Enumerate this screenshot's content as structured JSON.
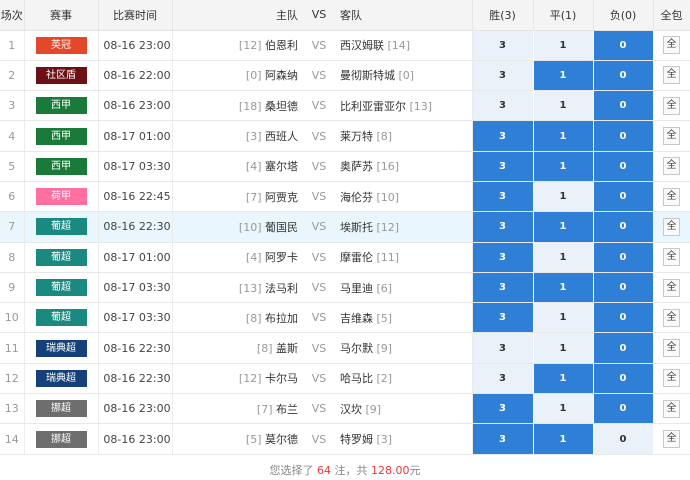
{
  "header": {
    "idx": "场次",
    "league": "赛事",
    "time": "比赛时间",
    "home": "主队",
    "vs": "VS",
    "away": "客队",
    "win": "胜(3)",
    "draw": "平(1)",
    "lose": "负(0)",
    "all": "全包"
  },
  "colors": {
    "selected_option": "#2f7fd6",
    "unselected_option": "#ebf1f8",
    "highlight_row": "#eaf6fd"
  },
  "matches": [
    {
      "idx": "1",
      "league": "英冠",
      "league_color": "#e4472a",
      "time": "08-16 23:00",
      "home_rank": "[12]",
      "home": "伯恩利",
      "vs": "VS",
      "away": "西汉姆联",
      "away_rank": "[14]",
      "win": "3",
      "draw": "1",
      "lose": "0",
      "sel": [
        false,
        false,
        true
      ],
      "all": "全"
    },
    {
      "idx": "2",
      "league": "社区盾",
      "league_color": "#6b1014",
      "time": "08-16 22:00",
      "home_rank": "[0]",
      "home": "阿森纳",
      "vs": "VS",
      "away": "曼彻斯特城",
      "away_rank": "[0]",
      "win": "3",
      "draw": "1",
      "lose": "0",
      "sel": [
        false,
        true,
        true
      ],
      "all": "全"
    },
    {
      "idx": "3",
      "league": "西甲",
      "league_color": "#1a7a3a",
      "time": "08-16 23:00",
      "home_rank": "[18]",
      "home": "桑坦德",
      "vs": "VS",
      "away": "比利亚雷亚尔",
      "away_rank": "[13]",
      "win": "3",
      "draw": "1",
      "lose": "0",
      "sel": [
        false,
        false,
        true
      ],
      "all": "全"
    },
    {
      "idx": "4",
      "league": "西甲",
      "league_color": "#1a7a3a",
      "time": "08-17 01:00",
      "home_rank": "[3]",
      "home": "西班人",
      "vs": "VS",
      "away": "莱万特",
      "away_rank": "[8]",
      "win": "3",
      "draw": "1",
      "lose": "0",
      "sel": [
        true,
        true,
        true
      ],
      "all": "全"
    },
    {
      "idx": "5",
      "league": "西甲",
      "league_color": "#1a7a3a",
      "time": "08-17 03:30",
      "home_rank": "[4]",
      "home": "塞尔塔",
      "vs": "VS",
      "away": "奥萨苏",
      "away_rank": "[16]",
      "win": "3",
      "draw": "1",
      "lose": "0",
      "sel": [
        true,
        true,
        true
      ],
      "all": "全"
    },
    {
      "idx": "6",
      "league": "荷甲",
      "league_color": "#ff6fa0",
      "time": "08-16 22:45",
      "home_rank": "[7]",
      "home": "阿贾克",
      "vs": "VS",
      "away": "海伦芬",
      "away_rank": "[10]",
      "win": "3",
      "draw": "1",
      "lose": "0",
      "sel": [
        true,
        false,
        true
      ],
      "all": "全"
    },
    {
      "idx": "7",
      "league": "葡超",
      "league_color": "#1a8a80",
      "time": "08-16 22:30",
      "home_rank": "[10]",
      "home": "葡国民",
      "vs": "VS",
      "away": "埃斯托",
      "away_rank": "[12]",
      "win": "3",
      "draw": "1",
      "lose": "0",
      "sel": [
        true,
        true,
        true
      ],
      "all": "全",
      "highlight": true
    },
    {
      "idx": "8",
      "league": "葡超",
      "league_color": "#1a8a80",
      "time": "08-17 01:00",
      "home_rank": "[4]",
      "home": "阿罗卡",
      "vs": "VS",
      "away": "摩雷伦",
      "away_rank": "[11]",
      "win": "3",
      "draw": "1",
      "lose": "0",
      "sel": [
        true,
        false,
        true
      ],
      "all": "全"
    },
    {
      "idx": "9",
      "league": "葡超",
      "league_color": "#1a8a80",
      "time": "08-17 03:30",
      "home_rank": "[13]",
      "home": "法马利",
      "vs": "VS",
      "away": "马里迪",
      "away_rank": "[6]",
      "win": "3",
      "draw": "1",
      "lose": "0",
      "sel": [
        true,
        true,
        true
      ],
      "all": "全"
    },
    {
      "idx": "10",
      "league": "葡超",
      "league_color": "#1a8a80",
      "time": "08-17 03:30",
      "home_rank": "[8]",
      "home": "布拉加",
      "vs": "VS",
      "away": "吉维森",
      "away_rank": "[5]",
      "win": "3",
      "draw": "1",
      "lose": "0",
      "sel": [
        true,
        false,
        true
      ],
      "all": "全"
    },
    {
      "idx": "11",
      "league": "瑞典超",
      "league_color": "#15407a",
      "time": "08-16 22:30",
      "home_rank": "[8]",
      "home": "盖斯",
      "vs": "VS",
      "away": "马尔默",
      "away_rank": "[9]",
      "win": "3",
      "draw": "1",
      "lose": "0",
      "sel": [
        false,
        false,
        true
      ],
      "all": "全"
    },
    {
      "idx": "12",
      "league": "瑞典超",
      "league_color": "#15407a",
      "time": "08-16 22:30",
      "home_rank": "[12]",
      "home": "卡尔马",
      "vs": "VS",
      "away": "哈马比",
      "away_rank": "[2]",
      "win": "3",
      "draw": "1",
      "lose": "0",
      "sel": [
        false,
        true,
        true
      ],
      "all": "全"
    },
    {
      "idx": "13",
      "league": "挪超",
      "league_color": "#6e6e6e",
      "time": "08-16 23:00",
      "home_rank": "[7]",
      "home": "布兰",
      "vs": "VS",
      "away": "汉坎",
      "away_rank": "[9]",
      "win": "3",
      "draw": "1",
      "lose": "0",
      "sel": [
        true,
        false,
        true
      ],
      "all": "全"
    },
    {
      "idx": "14",
      "league": "挪超",
      "league_color": "#6e6e6e",
      "time": "08-16 23:00",
      "home_rank": "[5]",
      "home": "莫尔德",
      "vs": "VS",
      "away": "特罗姆",
      "away_rank": "[3]",
      "win": "3",
      "draw": "1",
      "lose": "0",
      "sel": [
        true,
        true,
        false
      ],
      "all": "全"
    }
  ],
  "summary": {
    "prefix": "您选择了",
    "count": "64",
    "mid": "注，共",
    "amount": "128.00",
    "unit": "元"
  }
}
